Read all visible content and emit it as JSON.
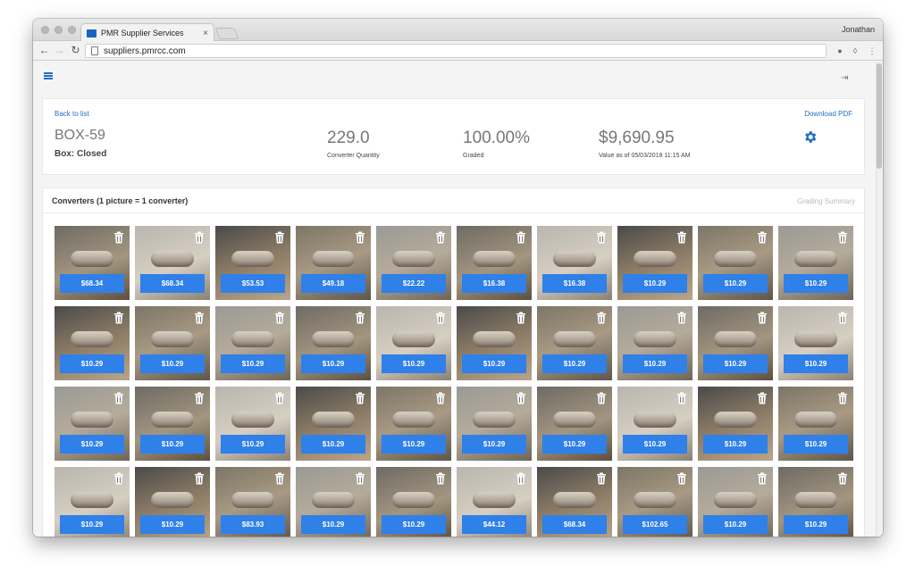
{
  "browser": {
    "tab_title": "PMR Supplier Services",
    "url": "suppliers.pmrcc.com",
    "user": "Jonathan"
  },
  "summary": {
    "back_label": "Back to list",
    "download_label": "Download PDF",
    "box_id": "BOX-59",
    "box_status": "Box: Closed",
    "quantity_value": "229.0",
    "quantity_label": "Converter Quantity",
    "graded_value": "100.00%",
    "graded_label": "Graded",
    "total_value": "$9,690.95",
    "total_label": "Value as of 05/03/2018 11:15 AM"
  },
  "converters": {
    "title": "Converters (1 picture = 1 converter)",
    "grading_summary": "Grading Summary",
    "prices": [
      "$68.34",
      "$68.34",
      "$53.53",
      "$49.18",
      "$22.22",
      "$16.38",
      "$16.38",
      "$10.29",
      "$10.29",
      "$10.29",
      "$10.29",
      "$10.29",
      "$10.29",
      "$10.29",
      "$10.29",
      "$10.29",
      "$10.29",
      "$10.29",
      "$10.29",
      "$10.29",
      "$10.29",
      "$10.29",
      "$10.29",
      "$10.29",
      "$10.29",
      "$10.29",
      "$10.29",
      "$10.29",
      "$10.29",
      "$10.29",
      "$10.29",
      "$10.29",
      "$83.93",
      "$10.29",
      "$10.29",
      "$44.12",
      "$68.34",
      "$102.65",
      "$10.29",
      "$10.29"
    ]
  },
  "colors": {
    "accent": "#1e6fc7",
    "price_button": "#2f80e8"
  }
}
